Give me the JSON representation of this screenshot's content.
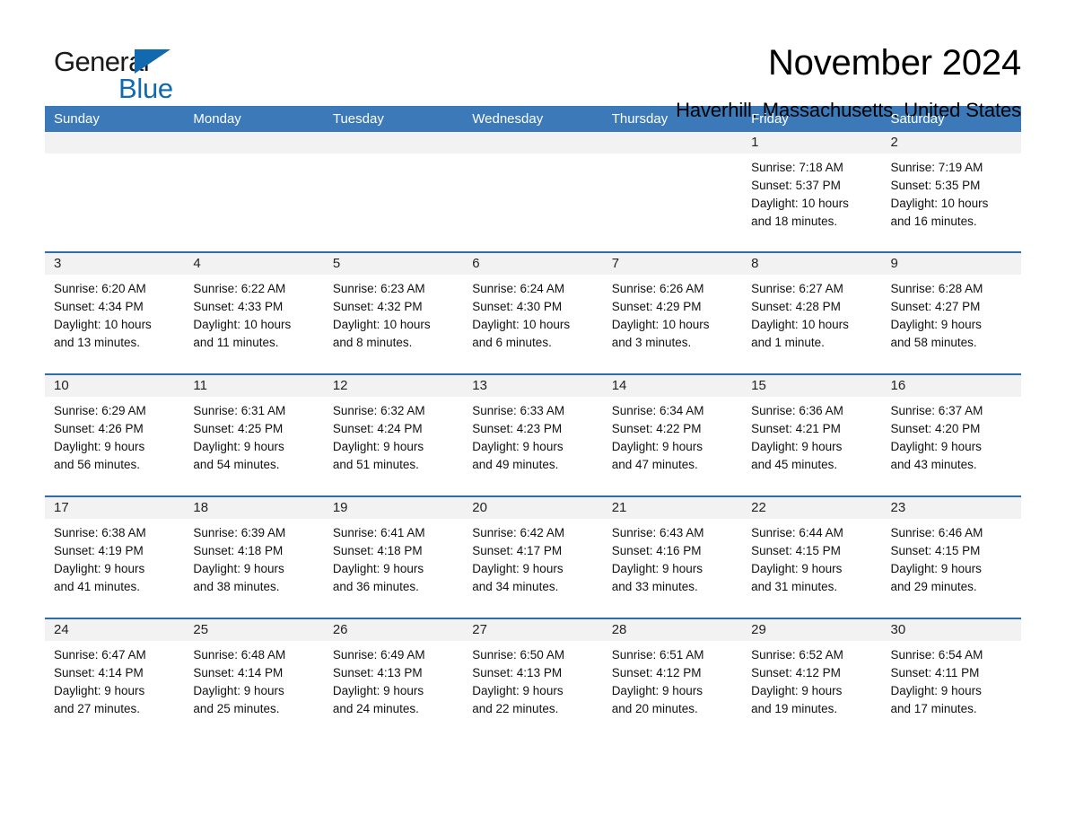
{
  "brand": {
    "name_part1": "General",
    "name_part2": "Blue",
    "triangle_icon": "triangle-icon",
    "accent_color": "#1169b0"
  },
  "header": {
    "title": "November 2024",
    "location": "Haverhill, Massachusetts, United States"
  },
  "calendar": {
    "header_bg": "#3b79b8",
    "row_border": "#2e6da8",
    "daynum_band": "#f2f2f2",
    "weekdays": [
      "Sunday",
      "Monday",
      "Tuesday",
      "Wednesday",
      "Thursday",
      "Friday",
      "Saturday"
    ],
    "weeks": [
      [
        {
          "day": "",
          "empty": true
        },
        {
          "day": "",
          "empty": true
        },
        {
          "day": "",
          "empty": true
        },
        {
          "day": "",
          "empty": true
        },
        {
          "day": "",
          "empty": true
        },
        {
          "day": "1",
          "sunrise": "Sunrise: 7:18 AM",
          "sunset": "Sunset: 5:37 PM",
          "daylight1": "Daylight: 10 hours",
          "daylight2": "and 18 minutes."
        },
        {
          "day": "2",
          "sunrise": "Sunrise: 7:19 AM",
          "sunset": "Sunset: 5:35 PM",
          "daylight1": "Daylight: 10 hours",
          "daylight2": "and 16 minutes."
        }
      ],
      [
        {
          "day": "3",
          "sunrise": "Sunrise: 6:20 AM",
          "sunset": "Sunset: 4:34 PM",
          "daylight1": "Daylight: 10 hours",
          "daylight2": "and 13 minutes."
        },
        {
          "day": "4",
          "sunrise": "Sunrise: 6:22 AM",
          "sunset": "Sunset: 4:33 PM",
          "daylight1": "Daylight: 10 hours",
          "daylight2": "and 11 minutes."
        },
        {
          "day": "5",
          "sunrise": "Sunrise: 6:23 AM",
          "sunset": "Sunset: 4:32 PM",
          "daylight1": "Daylight: 10 hours",
          "daylight2": "and 8 minutes."
        },
        {
          "day": "6",
          "sunrise": "Sunrise: 6:24 AM",
          "sunset": "Sunset: 4:30 PM",
          "daylight1": "Daylight: 10 hours",
          "daylight2": "and 6 minutes."
        },
        {
          "day": "7",
          "sunrise": "Sunrise: 6:26 AM",
          "sunset": "Sunset: 4:29 PM",
          "daylight1": "Daylight: 10 hours",
          "daylight2": "and 3 minutes."
        },
        {
          "day": "8",
          "sunrise": "Sunrise: 6:27 AM",
          "sunset": "Sunset: 4:28 PM",
          "daylight1": "Daylight: 10 hours",
          "daylight2": "and 1 minute."
        },
        {
          "day": "9",
          "sunrise": "Sunrise: 6:28 AM",
          "sunset": "Sunset: 4:27 PM",
          "daylight1": "Daylight: 9 hours",
          "daylight2": "and 58 minutes."
        }
      ],
      [
        {
          "day": "10",
          "sunrise": "Sunrise: 6:29 AM",
          "sunset": "Sunset: 4:26 PM",
          "daylight1": "Daylight: 9 hours",
          "daylight2": "and 56 minutes."
        },
        {
          "day": "11",
          "sunrise": "Sunrise: 6:31 AM",
          "sunset": "Sunset: 4:25 PM",
          "daylight1": "Daylight: 9 hours",
          "daylight2": "and 54 minutes."
        },
        {
          "day": "12",
          "sunrise": "Sunrise: 6:32 AM",
          "sunset": "Sunset: 4:24 PM",
          "daylight1": "Daylight: 9 hours",
          "daylight2": "and 51 minutes."
        },
        {
          "day": "13",
          "sunrise": "Sunrise: 6:33 AM",
          "sunset": "Sunset: 4:23 PM",
          "daylight1": "Daylight: 9 hours",
          "daylight2": "and 49 minutes."
        },
        {
          "day": "14",
          "sunrise": "Sunrise: 6:34 AM",
          "sunset": "Sunset: 4:22 PM",
          "daylight1": "Daylight: 9 hours",
          "daylight2": "and 47 minutes."
        },
        {
          "day": "15",
          "sunrise": "Sunrise: 6:36 AM",
          "sunset": "Sunset: 4:21 PM",
          "daylight1": "Daylight: 9 hours",
          "daylight2": "and 45 minutes."
        },
        {
          "day": "16",
          "sunrise": "Sunrise: 6:37 AM",
          "sunset": "Sunset: 4:20 PM",
          "daylight1": "Daylight: 9 hours",
          "daylight2": "and 43 minutes."
        }
      ],
      [
        {
          "day": "17",
          "sunrise": "Sunrise: 6:38 AM",
          "sunset": "Sunset: 4:19 PM",
          "daylight1": "Daylight: 9 hours",
          "daylight2": "and 41 minutes."
        },
        {
          "day": "18",
          "sunrise": "Sunrise: 6:39 AM",
          "sunset": "Sunset: 4:18 PM",
          "daylight1": "Daylight: 9 hours",
          "daylight2": "and 38 minutes."
        },
        {
          "day": "19",
          "sunrise": "Sunrise: 6:41 AM",
          "sunset": "Sunset: 4:18 PM",
          "daylight1": "Daylight: 9 hours",
          "daylight2": "and 36 minutes."
        },
        {
          "day": "20",
          "sunrise": "Sunrise: 6:42 AM",
          "sunset": "Sunset: 4:17 PM",
          "daylight1": "Daylight: 9 hours",
          "daylight2": "and 34 minutes."
        },
        {
          "day": "21",
          "sunrise": "Sunrise: 6:43 AM",
          "sunset": "Sunset: 4:16 PM",
          "daylight1": "Daylight: 9 hours",
          "daylight2": "and 33 minutes."
        },
        {
          "day": "22",
          "sunrise": "Sunrise: 6:44 AM",
          "sunset": "Sunset: 4:15 PM",
          "daylight1": "Daylight: 9 hours",
          "daylight2": "and 31 minutes."
        },
        {
          "day": "23",
          "sunrise": "Sunrise: 6:46 AM",
          "sunset": "Sunset: 4:15 PM",
          "daylight1": "Daylight: 9 hours",
          "daylight2": "and 29 minutes."
        }
      ],
      [
        {
          "day": "24",
          "sunrise": "Sunrise: 6:47 AM",
          "sunset": "Sunset: 4:14 PM",
          "daylight1": "Daylight: 9 hours",
          "daylight2": "and 27 minutes."
        },
        {
          "day": "25",
          "sunrise": "Sunrise: 6:48 AM",
          "sunset": "Sunset: 4:14 PM",
          "daylight1": "Daylight: 9 hours",
          "daylight2": "and 25 minutes."
        },
        {
          "day": "26",
          "sunrise": "Sunrise: 6:49 AM",
          "sunset": "Sunset: 4:13 PM",
          "daylight1": "Daylight: 9 hours",
          "daylight2": "and 24 minutes."
        },
        {
          "day": "27",
          "sunrise": "Sunrise: 6:50 AM",
          "sunset": "Sunset: 4:13 PM",
          "daylight1": "Daylight: 9 hours",
          "daylight2": "and 22 minutes."
        },
        {
          "day": "28",
          "sunrise": "Sunrise: 6:51 AM",
          "sunset": "Sunset: 4:12 PM",
          "daylight1": "Daylight: 9 hours",
          "daylight2": "and 20 minutes."
        },
        {
          "day": "29",
          "sunrise": "Sunrise: 6:52 AM",
          "sunset": "Sunset: 4:12 PM",
          "daylight1": "Daylight: 9 hours",
          "daylight2": "and 19 minutes."
        },
        {
          "day": "30",
          "sunrise": "Sunrise: 6:54 AM",
          "sunset": "Sunset: 4:11 PM",
          "daylight1": "Daylight: 9 hours",
          "daylight2": "and 17 minutes."
        }
      ]
    ]
  }
}
